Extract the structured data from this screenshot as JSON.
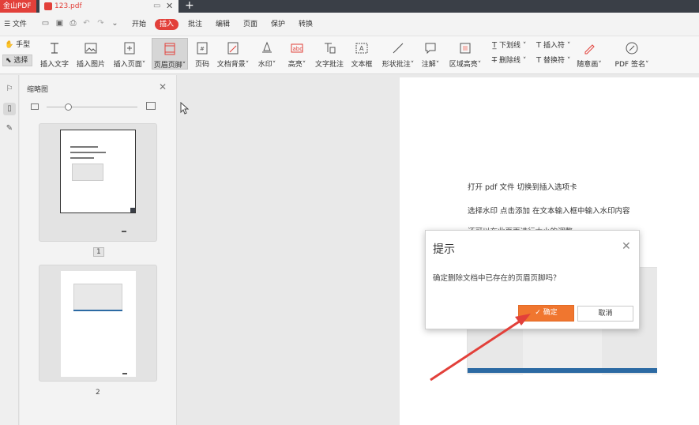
{
  "titlebar": {
    "app_name": "金山PDF",
    "doc_tab": "123.pdf",
    "pin_icon": "pin-icon",
    "close_icon": "close-icon",
    "new_tab": "+"
  },
  "menubar": {
    "file": "☰ 文件",
    "tabs": [
      "开始",
      "插入",
      "批注",
      "编辑",
      "页面",
      "保护",
      "转换"
    ],
    "active_tab": "插入"
  },
  "toolbar": {
    "hand": "手型",
    "select": "选择",
    "tools": [
      "插入文字",
      "插入图片",
      "插入页面",
      "页眉页脚",
      "页码",
      "文档背景",
      "水印",
      "高亮",
      "文字批注",
      "文本框",
      "形状批注",
      "注解",
      "区域高亮"
    ],
    "underline": "下划线",
    "strikethrough": "删除线",
    "insert_mark": "插入符",
    "replace_mark": "替换符",
    "freehand": "随意画",
    "pdf_sign": "PDF 签名"
  },
  "thumbpanel": {
    "title": "缩略图",
    "page1": "1",
    "page2": "2"
  },
  "document": {
    "line1": "打开 pdf 文件    切换到插入选项卡",
    "line2": "选择水印      点击添加    在文本输入框中输入水印内容",
    "line3_partial": "还可以在此页面进行大小的调整"
  },
  "dialog": {
    "title": "提示",
    "message": "确定删除文档中已存在的页眉页脚吗？",
    "ok": "确定",
    "cancel": "取消"
  },
  "colors": {
    "brand": "#e2403a",
    "ok_button": "#f0762f",
    "arrow": "#e2403a"
  }
}
